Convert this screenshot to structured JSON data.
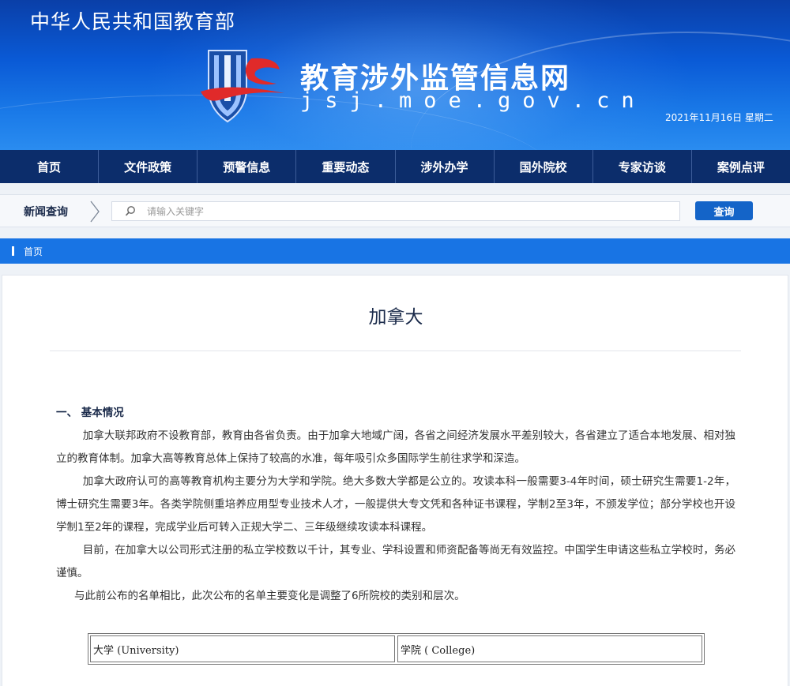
{
  "header": {
    "ministry": "中华人民共和国教育部",
    "site_title": "教育涉外监管信息网",
    "site_domain": "jsj.moe.gov.cn",
    "date": "2021年11月16日 星期二"
  },
  "nav": {
    "items": [
      {
        "label": "首页"
      },
      {
        "label": "文件政策"
      },
      {
        "label": "预警信息"
      },
      {
        "label": "重要动态"
      },
      {
        "label": "涉外办学"
      },
      {
        "label": "国外院校"
      },
      {
        "label": "专家访谈"
      },
      {
        "label": "案例点评"
      }
    ]
  },
  "search": {
    "label": "新闻查询",
    "placeholder": "请输入关键字",
    "button": "查询"
  },
  "breadcrumb": {
    "items": [
      "首页"
    ]
  },
  "article": {
    "title": "加拿大",
    "section_heading": "一、 基本情况",
    "paragraphs": [
      "加拿大联邦政府不设教育部，教育由各省负责。由于加拿大地域广阔，各省之间经济发展水平差别较大，各省建立了适合本地发展、相对独立的教育体制。加拿大高等教育总体上保持了较高的水准，每年吸引众多国际学生前往求学和深造。",
      "加拿大政府认可的高等教育机构主要分为大学和学院。绝大多数大学都是公立的。攻读本科一般需要3-4年时间，硕士研究生需要1-2年，博士研究生需要3年。各类学院侧重培养应用型专业技术人才，一般提供大专文凭和各种证书课程，学制2至3年，不颁发学位；部分学校也开设学制1至2年的课程，完成学业后可转入正规大学二、三年级继续攻读本科课程。",
      "目前，在加拿大以公司形式注册的私立学校数以千计，其专业、学科设置和师资配备等尚无有效监控。中国学生申请这些私立学校时，务必谨慎。"
    ],
    "note": "与此前公布的名单相比，此次公布的名单主要变化是调整了6所院校的类别和层次。",
    "table": {
      "headers": [
        "大学 (University)",
        "学院 ( College)"
      ]
    }
  },
  "colors": {
    "nav_bg": "#0c2d6b",
    "breadcrumb_bg": "#1874e4",
    "button_bg": "#1464c8",
    "logo_red": "#e02a2a",
    "logo_blue": "#1a4fa8"
  }
}
